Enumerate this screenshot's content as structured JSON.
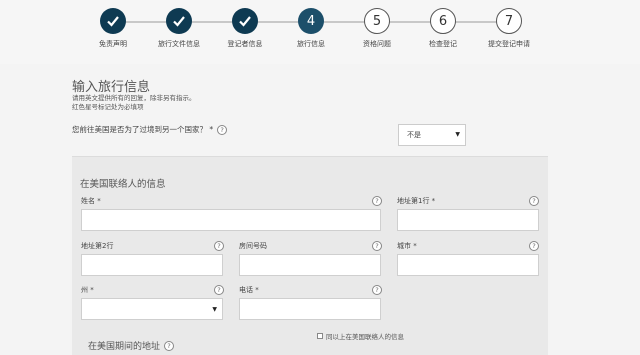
{
  "stepper": {
    "steps": [
      {
        "number": "✓",
        "label": "免责声明",
        "state": "done"
      },
      {
        "number": "✓",
        "label": "旅行文件信息",
        "state": "done"
      },
      {
        "number": "✓",
        "label": "登记者信息",
        "state": "done"
      },
      {
        "number": "4",
        "label": "旅行信息",
        "state": "active"
      },
      {
        "number": "5",
        "label": "资格问题",
        "state": "todo"
      },
      {
        "number": "6",
        "label": "检查登记",
        "state": "todo"
      },
      {
        "number": "7",
        "label": "提交登记申请",
        "state": "todo"
      }
    ]
  },
  "form": {
    "heading": "输入旅行信息",
    "intro_line1": "请用英文提供所有的回复，除非另有指示。",
    "intro_line2": "红色星号标记处为必填项",
    "transit_question": "您前往美国是否为了过境到另一个国家？ *",
    "transit_answer": "不是",
    "contact_section_title": "在美国联络人的信息",
    "fields": {
      "name": "姓名 *",
      "address1": "地址第1行 *",
      "address2": "地址第2行",
      "apartment": "房间号码",
      "city": "城市 *",
      "state": "州 *",
      "phone": "电话 *"
    },
    "same_address_checkbox": "同以上在美国联络人的信息",
    "address_section_title": "在美国期间的地址",
    "help_glyph": "?"
  },
  "colors": {
    "step_done": "#0e3a52",
    "step_active": "#1c4f6a",
    "panel_bg": "#e9e9e9"
  }
}
